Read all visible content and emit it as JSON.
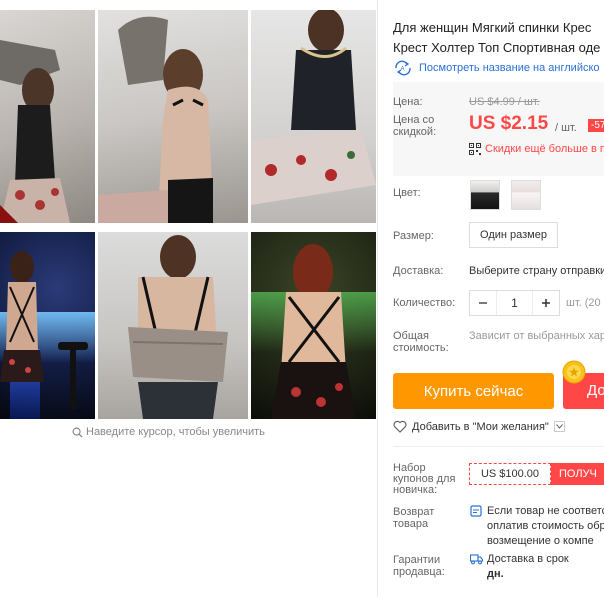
{
  "gallery": {
    "zoom_hint": "Наведите курсор, чтобы увеличить"
  },
  "product": {
    "title_line1": "Для женщин Мягкий спинки Крес",
    "title_line2": "Крест Холтер Топ Спортивная оде",
    "translate_link": "Посмотреть название на английско"
  },
  "price": {
    "price_label": "Цена:",
    "old_price": "US $4.99 / шт.",
    "discount_label": "Цена со скидкой:",
    "new_price": "US $2.15",
    "per_unit": "/ шт.",
    "discount_badge": "-57",
    "more_discounts": "Скидки ещё больше в п"
  },
  "options": {
    "color_label": "Цвет:",
    "size_label": "Размер:",
    "size_value": "Один размер",
    "shipping_label": "Доставка:",
    "shipping_value": "Выберите страну отправки",
    "quantity_label": "Количество:",
    "quantity_value": "1",
    "quantity_unit": "шт. (20",
    "total_label": "Общая стоимость:",
    "total_value": "Зависит от выбранных хар"
  },
  "actions": {
    "buy_now": "Купить сейчас",
    "add_to_cart": "До",
    "wishlist": "Добавить в \"Мои желания\""
  },
  "extras": {
    "coupon_label": "Набор купонов для новичка:",
    "coupon_amount": "US $100.00",
    "coupon_get": "ПОЛУЧ",
    "return_label": "Возврат товара",
    "return_line1": "Если товар не соответс",
    "return_line2": "оплатив стоимость обр",
    "return_line3": "возмещение о компе",
    "guarantee_label": "Гарантии продавца:",
    "guarantee_line1": "Доставка в срок",
    "guarantee_line2": "дн."
  },
  "colors": {
    "accent_orange": "#ff9700",
    "accent_red": "#ff4747",
    "link_blue": "#2a6fd6"
  }
}
